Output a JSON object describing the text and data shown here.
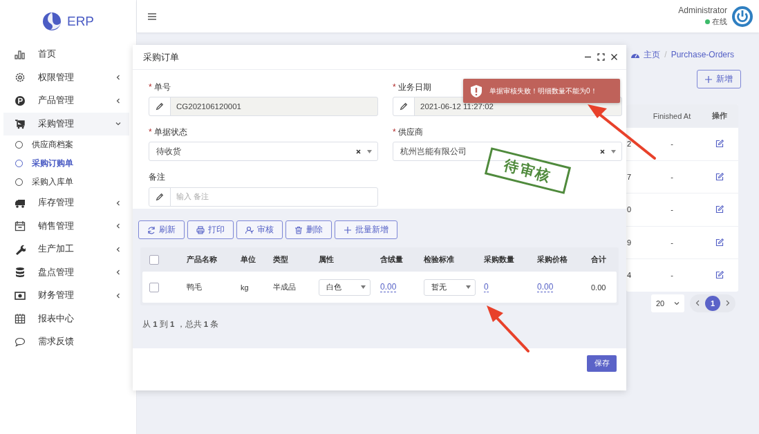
{
  "sidebar": {
    "logo": "ERP",
    "items": [
      {
        "label": "首页",
        "kind": "link"
      },
      {
        "label": "权限管理",
        "kind": "menu",
        "expanded": false
      },
      {
        "label": "产品管理",
        "kind": "menu",
        "expanded": false
      },
      {
        "label": "采购管理",
        "kind": "menu",
        "expanded": true,
        "children": [
          {
            "label": "供应商档案",
            "selected": false
          },
          {
            "label": "采购订购单",
            "selected": true
          },
          {
            "label": "采购入库单",
            "selected": false
          }
        ]
      },
      {
        "label": "库存管理",
        "kind": "menu",
        "expanded": false
      },
      {
        "label": "销售管理",
        "kind": "menu",
        "expanded": false
      },
      {
        "label": "生产加工",
        "kind": "menu",
        "expanded": false
      },
      {
        "label": "盘点管理",
        "kind": "menu",
        "expanded": false
      },
      {
        "label": "财务管理",
        "kind": "menu",
        "expanded": false
      },
      {
        "label": "报表中心",
        "kind": "link"
      },
      {
        "label": "需求反馈",
        "kind": "link"
      }
    ]
  },
  "topbar": {
    "user": "Administrator",
    "status": "在线",
    "online": true
  },
  "breadcrumb": {
    "items": [
      "主页",
      "Purchase-Orders"
    ],
    "separators": [
      "/"
    ]
  },
  "add_button": "新增",
  "background_table": {
    "columns": [
      "Finished At",
      "操作"
    ],
    "rows": [
      {
        "column_1": "2",
        "finished_at": "-"
      },
      {
        "column_1": "7",
        "finished_at": "-"
      },
      {
        "column_1": "0",
        "finished_at": "-"
      },
      {
        "column_1": "9",
        "finished_at": "-"
      },
      {
        "column_1": "4",
        "finished_at": "-"
      }
    ]
  },
  "pagination": {
    "page_size": "20",
    "pages": [
      {
        "label": "1",
        "selected": true
      }
    ]
  },
  "modal": {
    "title": "采购订单",
    "fields": [
      {
        "label": "单号",
        "required_mark": "*",
        "kind": "text",
        "value": "CG202106120001",
        "readonly": true
      },
      {
        "label": "业务日期",
        "required_mark": "*",
        "kind": "text",
        "value": "2021-06-12 11:27:02",
        "readonly": true
      },
      {
        "label": "单据状态",
        "required_mark": "*",
        "kind": "select",
        "value": "待收货"
      },
      {
        "label": "供应商",
        "required_mark": "*",
        "kind": "select",
        "value": "杭州岂能有限公司"
      },
      {
        "label": "备注",
        "kind": "text",
        "placeholder": "输入 备注",
        "readonly": false
      }
    ],
    "stamp": "待审核",
    "toolbar": [
      "刷新",
      "打印",
      "审核",
      "删除",
      "批量新增"
    ],
    "table": {
      "select_all_checked": false,
      "columns": [
        "产品名称",
        "单位",
        "类型",
        "属性",
        "含绒量",
        "检验标准",
        "采购数量",
        "采购价格",
        "合计"
      ],
      "rows": [
        {
          "checked": false,
          "cells": [
            {
              "kind": "text",
              "value": "鸭毛"
            },
            {
              "kind": "text",
              "value": "kg"
            },
            {
              "kind": "text",
              "value": "半成品"
            },
            {
              "kind": "select",
              "value": "白色"
            },
            {
              "kind": "editable",
              "value": "0.00"
            },
            {
              "kind": "select",
              "value": "暂无"
            },
            {
              "kind": "editable",
              "value": "0"
            },
            {
              "kind": "editable",
              "value": "0.00"
            },
            {
              "kind": "text",
              "value": "0.00"
            }
          ]
        }
      ]
    },
    "summary": "从 **1** 到 **1** ，总共 **1** 条",
    "save_button": "保存"
  },
  "toast": {
    "message": "单据审核失败！明细数量不能为0！"
  }
}
